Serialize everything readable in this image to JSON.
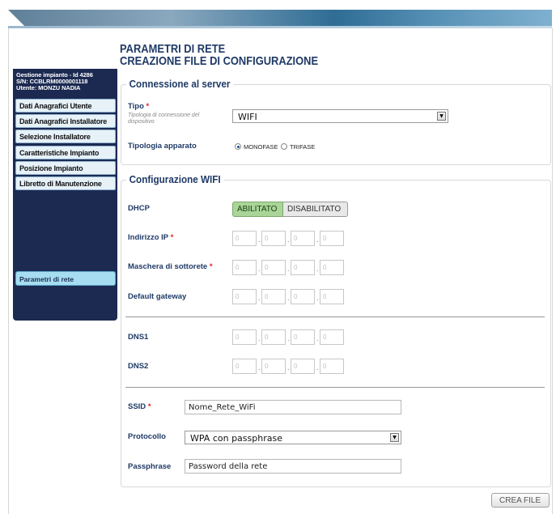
{
  "header": {
    "title_line1": "PARAMETRI DI RETE",
    "title_line2": "CREAZIONE FILE DI CONFIGURAZIONE"
  },
  "sidebar": {
    "info_line1": "Gestione impianto - Id 4286",
    "info_line2": "S/N: CCBLRM0000001118",
    "info_line3": "Utente: MONZU NADIA",
    "items": [
      {
        "label": "Dati Anagrafici Utente"
      },
      {
        "label": "Dati Anagrafici Installatore"
      },
      {
        "label": "Selezione Installatore"
      },
      {
        "label": "Caratteristiche Impianto"
      },
      {
        "label": "Posizione Impianto"
      },
      {
        "label": "Libretto di Manutenzione"
      }
    ],
    "active_item": "Parametri di rete"
  },
  "server": {
    "legend": "Connessione al server",
    "tipo_label": "Tipo",
    "required_mark": "*",
    "tipo_hint": "Tipologia di connessione del dispositivo",
    "tipo_value": "WIFI",
    "apparato_label": "Tipologia apparato",
    "monofase_label": "MONOFASE",
    "trifase_label": "TRIFASE",
    "selected_apparato": "MONOFASE"
  },
  "wifi": {
    "legend": "Configurazione WIFI",
    "dhcp_label": "DHCP",
    "dhcp_on": "ABILITATO",
    "dhcp_off": "DISABILITATO",
    "dhcp_selected": "ABILITATO",
    "ip_label": "Indirizzo IP",
    "mask_label": "Maschera di sottorete",
    "gateway_label": "Default gateway",
    "dns1_label": "DNS1",
    "dns2_label": "DNS2",
    "ip_placeholder": "0",
    "dot": ".",
    "ssid_label": "SSID",
    "ssid_value": "Nome_Rete_WiFi",
    "protocollo_label": "Protocollo",
    "protocollo_value": "WPA con passphrase",
    "passphrase_label": "Passphrase",
    "passphrase_value": "Password della rete"
  },
  "actions": {
    "crea_file": "CREA FILE"
  },
  "colors": {
    "sidebar_bg": "#1c2a52",
    "title": "#1f3a66",
    "required": "#e2231a",
    "dhcp_active": "#a9d598"
  }
}
